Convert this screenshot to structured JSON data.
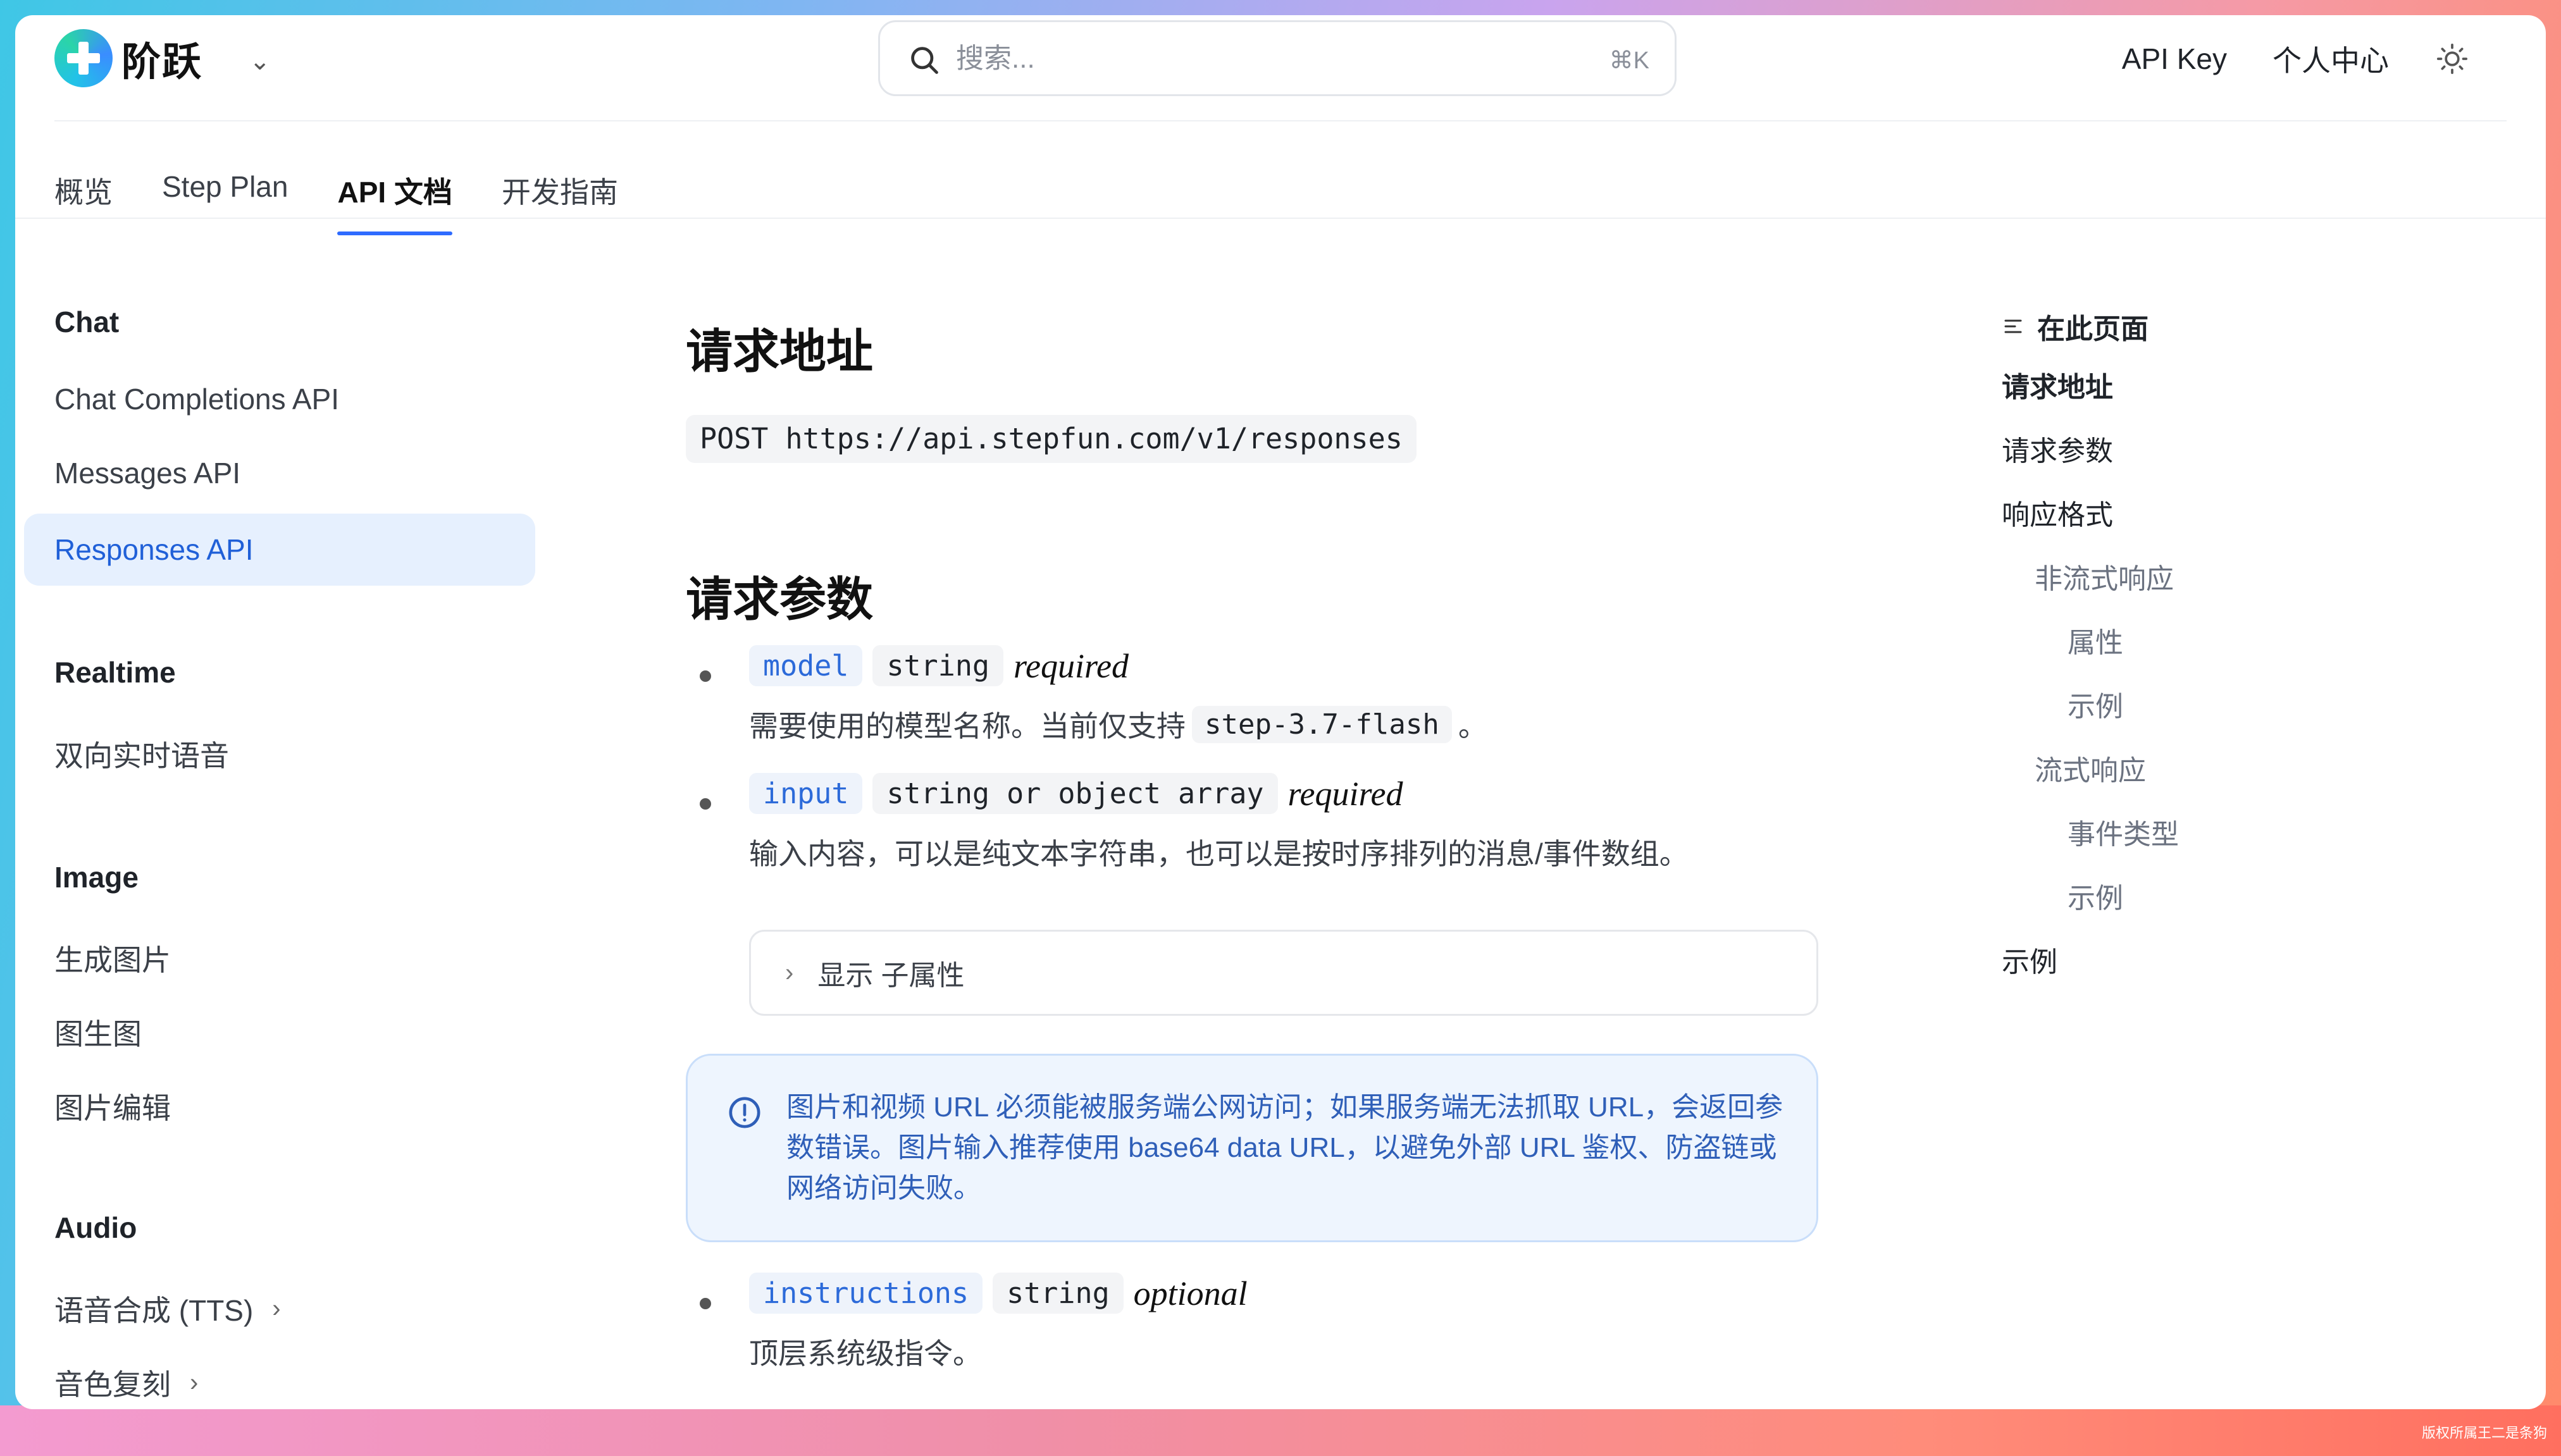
{
  "brand": {
    "name": "阶跃"
  },
  "search": {
    "placeholder": "搜索...",
    "shortcut": "⌘K"
  },
  "header": {
    "links": [
      "API Key",
      "个人中心"
    ]
  },
  "tabs": [
    {
      "label": "概览",
      "active": false
    },
    {
      "label": "Step Plan",
      "active": false
    },
    {
      "label": "API 文档",
      "active": true
    },
    {
      "label": "开发指南",
      "active": false
    }
  ],
  "sidebar": {
    "groups": [
      {
        "title": "Chat",
        "items": [
          {
            "label": "Chat Completions API"
          },
          {
            "label": "Messages API"
          },
          {
            "label": "Responses API",
            "active": true
          }
        ]
      },
      {
        "title": "Realtime",
        "items": [
          {
            "label": "双向实时语音"
          }
        ]
      },
      {
        "title": "Image",
        "items": [
          {
            "label": "生成图片"
          },
          {
            "label": "图生图"
          },
          {
            "label": "图片编辑"
          }
        ]
      },
      {
        "title": "Audio",
        "items": [
          {
            "label": "语音合成 (TTS)",
            "expandable": true
          },
          {
            "label": "音色复刻",
            "expandable": true
          }
        ]
      }
    ]
  },
  "main": {
    "endpoint_heading": "请求地址",
    "endpoint": "POST https://api.stepfun.com/v1/responses",
    "params_heading": "请求参数",
    "params": [
      {
        "name": "model",
        "type": "string",
        "requirement": "required",
        "desc_before": "需要使用的模型名称。当前仅支持",
        "desc_code": "step-3.7-flash",
        "desc_after": "。"
      },
      {
        "name": "input",
        "type": "string or object array",
        "requirement": "required",
        "desc_before": "输入内容，可以是纯文本字符串，也可以是按时序排列的消息/事件数组。"
      },
      {
        "name": "instructions",
        "type": "string",
        "requirement": "optional",
        "desc_before": "顶层系统级指令。"
      }
    ],
    "expander_label": "显示 子属性",
    "callout": "图片和视频 URL 必须能被服务端公网访问；如果服务端无法抓取 URL，会返回参数错误。图片输入推荐使用 base64 data URL，以避免外部 URL 鉴权、防盗链或网络访问失败。"
  },
  "toc": {
    "title": "在此页面",
    "items": [
      {
        "label": "请求地址",
        "level": 1,
        "active": true
      },
      {
        "label": "请求参数",
        "level": 1
      },
      {
        "label": "响应格式",
        "level": 1
      },
      {
        "label": "非流式响应",
        "level": 2
      },
      {
        "label": "属性",
        "level": 3
      },
      {
        "label": "示例",
        "level": 3
      },
      {
        "label": "流式响应",
        "level": 2
      },
      {
        "label": "事件类型",
        "level": 3
      },
      {
        "label": "示例",
        "level": 3
      },
      {
        "label": "示例",
        "level": 1
      }
    ]
  },
  "watermark": "版权所属王二是条狗",
  "colors": {
    "accent": "#2e6bff",
    "active_bg": "#e6f0fe",
    "callout_text": "#2f5fb8"
  }
}
